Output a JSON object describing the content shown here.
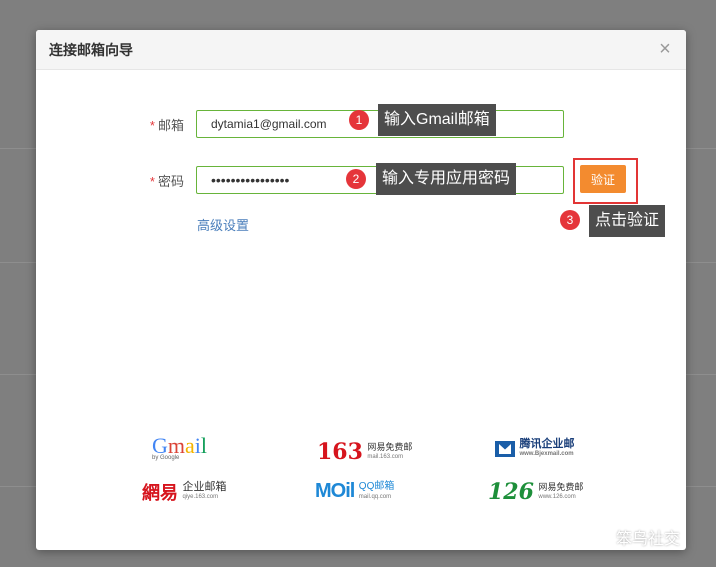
{
  "dialog": {
    "title": "连接邮箱向导",
    "close_glyph": "×"
  },
  "form": {
    "required_mark": "*",
    "email_label": "邮箱",
    "email_value": "dytamia1@gmail.com",
    "password_label": "密码",
    "password_value": "••••••••••••••••",
    "verify_label": "验证",
    "advanced_label": "高级设置"
  },
  "annotations": [
    {
      "number": "1",
      "text": "输入Gmail邮箱"
    },
    {
      "number": "2",
      "text": "输入专用应用密码"
    },
    {
      "number": "3",
      "text": "点击验证"
    }
  ],
  "providers": {
    "gmail": {
      "name": "Gmail",
      "sub": "by Google"
    },
    "n163": {
      "big": "163",
      "line1": "网易免费邮",
      "line2": "mail.163.com"
    },
    "tencent": {
      "line1": "腾讯企业邮",
      "line2": "www.Bjexmail.com"
    },
    "netease_ent": {
      "brand": "網易",
      "line1": "企业邮箱",
      "line2": "qiye.163.com"
    },
    "qq": {
      "brand": "MOil",
      "line1": "QQ邮箱",
      "line2": "mail.qq.com"
    },
    "n126": {
      "big": "126",
      "line1": "网易免费邮",
      "line2": "www.126.com"
    }
  },
  "watermark": {
    "text": "笨鸟社交"
  },
  "colors": {
    "accent_orange": "#f38b2f",
    "field_border": "#67b43a",
    "annotation_red": "#e5353a",
    "tip_bg": "#4d4d4d"
  }
}
